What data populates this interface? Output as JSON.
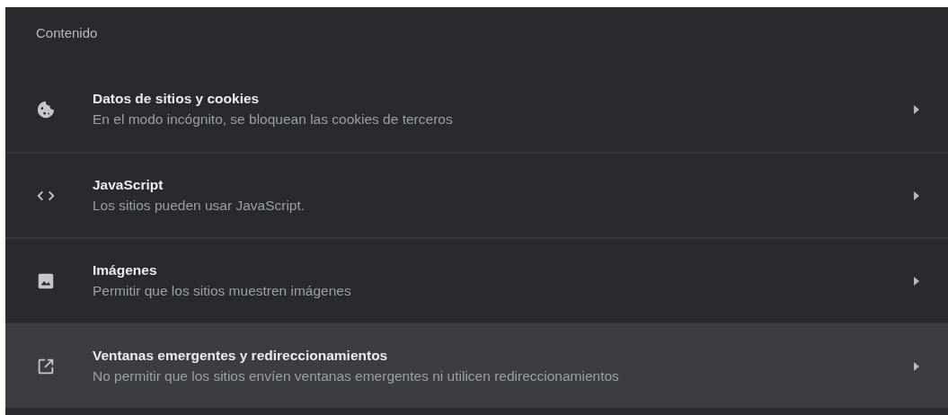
{
  "section_title": "Contenido",
  "items": [
    {
      "kind": "cookie",
      "title": "Datos de sitios y cookies",
      "subtitle": "En el modo incógnito, se bloquean las cookies de terceros",
      "highlighted": false
    },
    {
      "kind": "code",
      "title": "JavaScript",
      "subtitle": "Los sitios pueden usar JavaScript.",
      "highlighted": false
    },
    {
      "kind": "image",
      "title": "Imágenes",
      "subtitle": "Permitir que los sitios muestren imágenes",
      "highlighted": false
    },
    {
      "kind": "open",
      "title": "Ventanas emergentes y redireccionamientos",
      "subtitle": "No permitir que los sitios envíen ventanas emergentes ni utilicen redireccionamientos",
      "highlighted": true
    }
  ]
}
